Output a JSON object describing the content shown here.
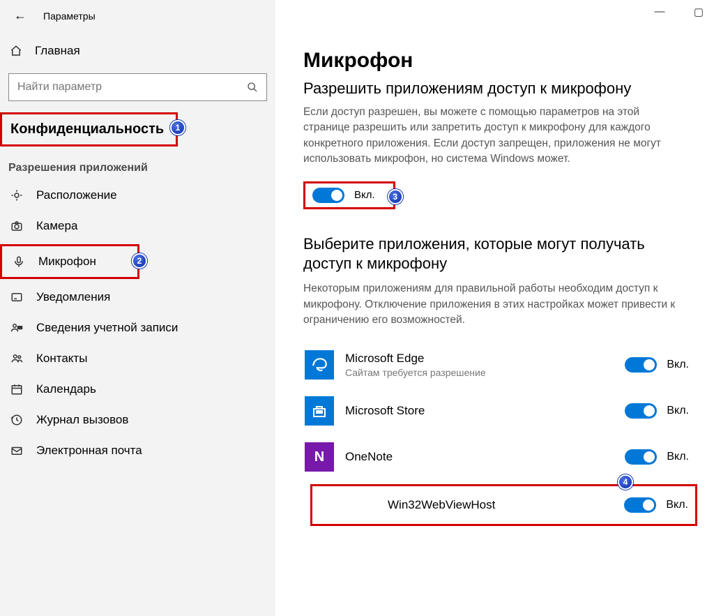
{
  "window": {
    "title": "Параметры",
    "minimize_glyph": "—",
    "maximize_glyph": "▢"
  },
  "sidebar": {
    "home": "Главная",
    "search_placeholder": "Найти параметр",
    "privacy_header": "Конфиденциальность",
    "permissions_header": "Разрешения приложений",
    "items": [
      {
        "label": "Расположение"
      },
      {
        "label": "Камера"
      },
      {
        "label": "Микрофон"
      },
      {
        "label": "Уведомления"
      },
      {
        "label": "Сведения учетной записи"
      },
      {
        "label": "Контакты"
      },
      {
        "label": "Календарь"
      },
      {
        "label": "Журнал вызовов"
      },
      {
        "label": "Электронная почта"
      }
    ]
  },
  "main": {
    "heading": "Микрофон",
    "allow_title": "Разрешить приложениям доступ к микрофону",
    "allow_desc": "Если доступ разрешен, вы можете с помощью параметров на этой странице разрешить или запретить доступ к микрофону для каждого конкретного приложения. Если доступ запрещен, приложения не могут использовать микрофон, но система Windows может.",
    "toggle_on_label": "Вкл.",
    "choose_title": "Выберите приложения, которые могут получать доступ к микрофону",
    "choose_desc": "Некоторым приложениям для правильной работы необходим доступ к микрофону. Отключение приложения в этих настройках может привести к ограничению его возможностей.",
    "apps": [
      {
        "name": "Microsoft Edge",
        "sub": "Сайтам требуется разрешение",
        "state": "Вкл."
      },
      {
        "name": "Microsoft Store",
        "sub": "",
        "state": "Вкл."
      },
      {
        "name": "OneNote",
        "sub": "",
        "state": "Вкл."
      },
      {
        "name": "Win32WebViewHost",
        "sub": "",
        "state": "Вкл."
      }
    ]
  },
  "annotations": {
    "badge1": "1",
    "badge2": "2",
    "badge3": "3",
    "badge4": "4"
  }
}
